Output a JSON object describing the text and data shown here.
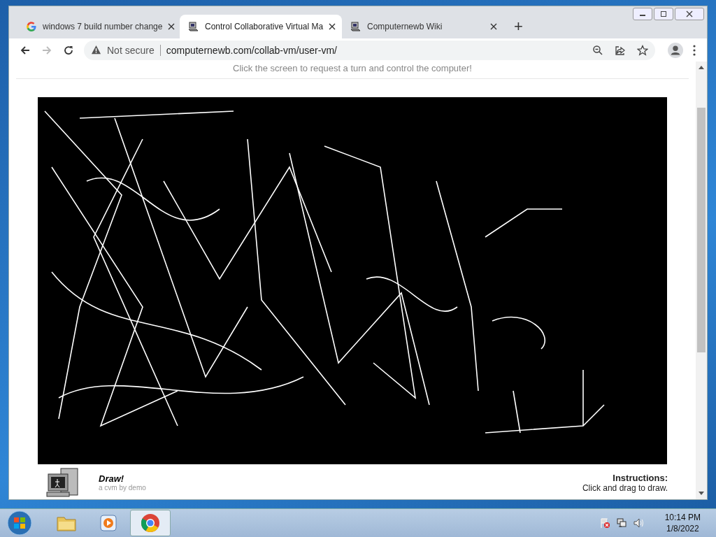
{
  "browser": {
    "tabs": [
      {
        "kind": "google",
        "title": "windows 7 build number change",
        "selected": false
      },
      {
        "kind": "vm",
        "title": "Control Collaborative Virtual Ma",
        "selected": true
      },
      {
        "kind": "vm",
        "title": "Computernewb Wiki",
        "selected": false
      }
    ],
    "new_tab": "+",
    "address": {
      "security": "Not secure",
      "url": "computernewb.com/collab-vm/user-vm/"
    }
  },
  "page": {
    "notice": "Click the screen to request a turn and control the computer!",
    "vm": {
      "title": "Draw!",
      "subtitle": "a cvm by demo",
      "instructions_title": "Instructions:",
      "instructions": "Click and drag to draw."
    }
  },
  "taskbar": {
    "apps": [
      {
        "kind": "explorer",
        "active": false
      },
      {
        "kind": "media",
        "active": false
      },
      {
        "kind": "chrome",
        "active": true
      }
    ],
    "clock": {
      "time": "10:14 PM",
      "date": "1/8/2022"
    }
  }
}
